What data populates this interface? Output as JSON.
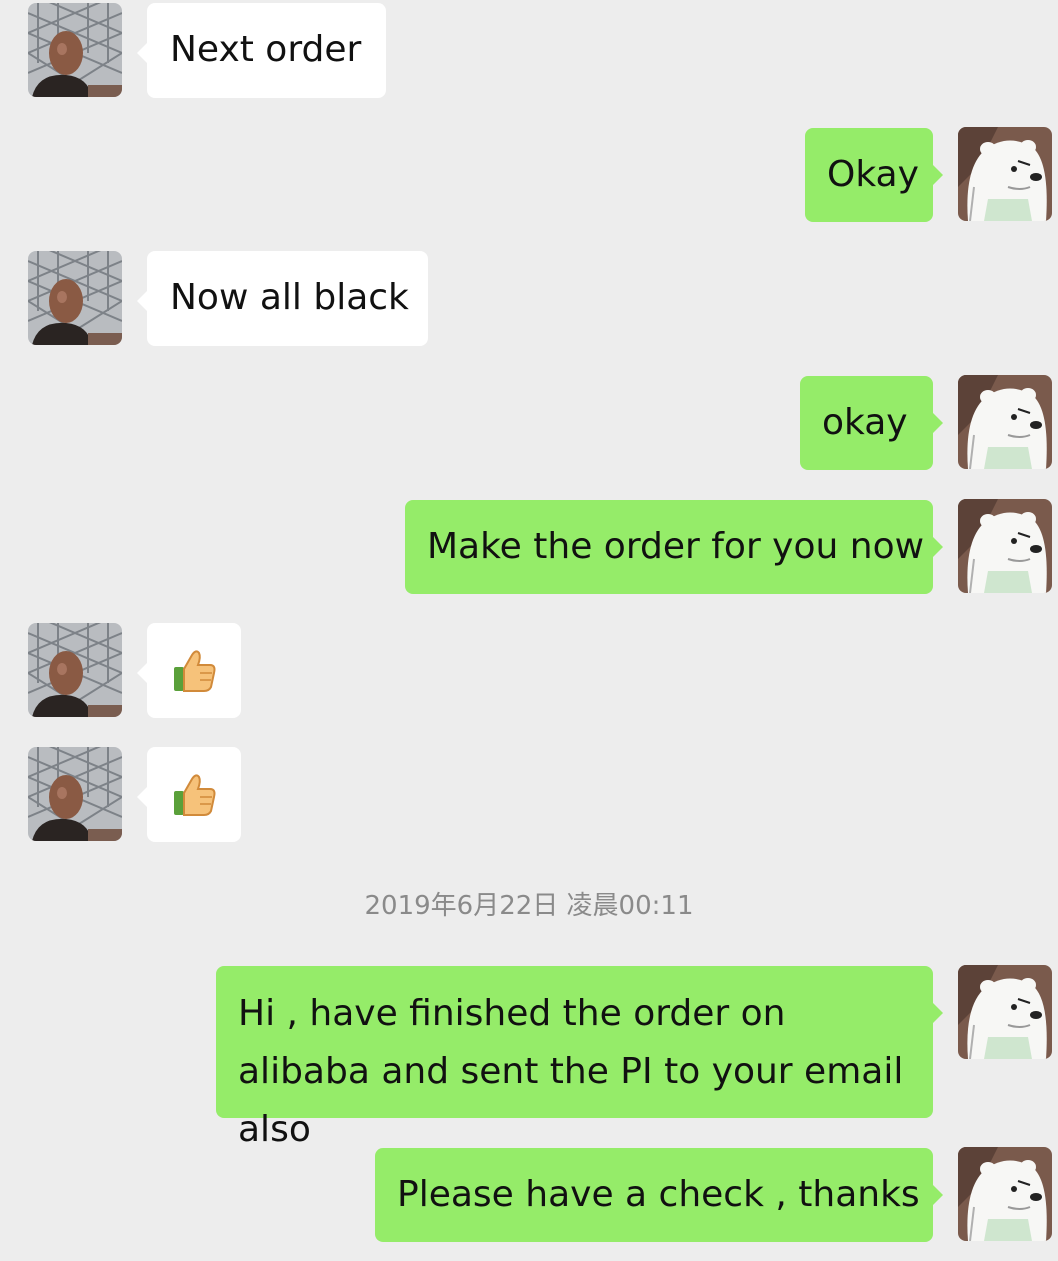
{
  "chat": {
    "messages": [
      {
        "side": "in",
        "text": "Next order"
      },
      {
        "side": "out",
        "text": "Okay"
      },
      {
        "side": "in",
        "text": "Now all black"
      },
      {
        "side": "out",
        "text": "okay"
      },
      {
        "side": "out",
        "text": "Make the order for you now"
      },
      {
        "side": "in",
        "emoji": "thumbs-up"
      },
      {
        "side": "in",
        "emoji": "thumbs-up"
      },
      {
        "side": "out",
        "text": "Hi , have finished the order on alibaba and sent the PI to your email also"
      },
      {
        "side": "out",
        "text": "Please have a check , thanks"
      }
    ],
    "timestamp": "2019年6月22日 凌晨00:11"
  },
  "colors": {
    "background": "#ededed",
    "incoming_bubble": "#ffffff",
    "outgoing_bubble": "#95ec69",
    "timestamp_text": "#8a8a8a"
  },
  "icons": {
    "contact_avatar": "man-photo-avatar",
    "self_avatar": "polar-bear-avatar",
    "emoji": "thumbs-up-icon"
  }
}
